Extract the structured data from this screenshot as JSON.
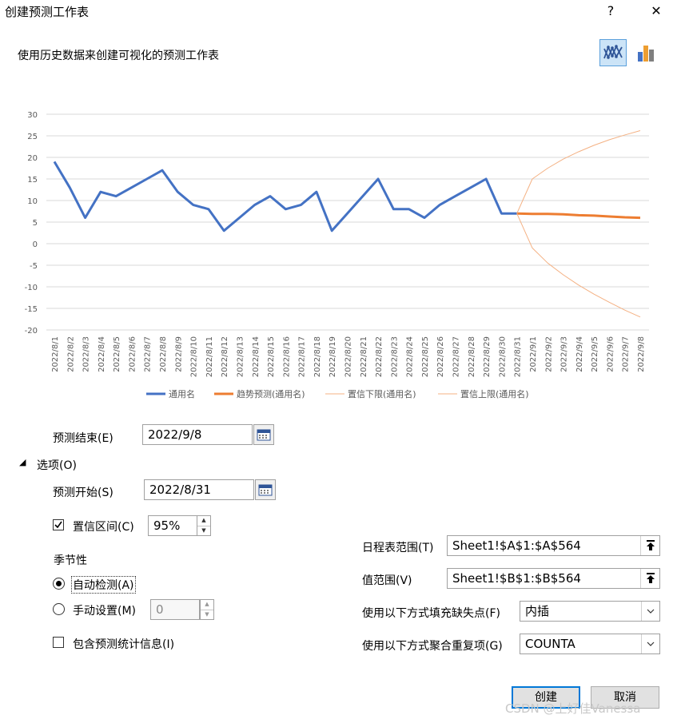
{
  "dialog": {
    "title": "创建预测工作表",
    "help_label": "?",
    "close_label": "✕",
    "subtitle": "使用历史数据来创建可视化的预测工作表"
  },
  "chart_types": [
    {
      "name": "line-chart",
      "active": true
    },
    {
      "name": "column-chart",
      "active": false
    }
  ],
  "colors": {
    "series_history": "#4472c4",
    "series_forecast": "#ed7d31",
    "series_bounds": "#f4b183",
    "gridline": "#d9d9d9",
    "accent": "#0078d7"
  },
  "chart_data": {
    "type": "line",
    "ylim": [
      -20,
      30
    ],
    "yticks": [
      "30",
      "25",
      "20",
      "15",
      "10",
      "5",
      "0",
      "-5",
      "-10",
      "-15",
      "-20"
    ],
    "x": [
      "2022/8/1",
      "2022/8/2",
      "2022/8/3",
      "2022/8/4",
      "2022/8/5",
      "2022/8/6",
      "2022/8/7",
      "2022/8/8",
      "2022/8/9",
      "2022/8/10",
      "2022/8/11",
      "2022/8/12",
      "2022/8/13",
      "2022/8/14",
      "2022/8/15",
      "2022/8/16",
      "2022/8/17",
      "2022/8/18",
      "2022/8/19",
      "2022/8/20",
      "2022/8/21",
      "2022/8/22",
      "2022/8/23",
      "2022/8/24",
      "2022/8/25",
      "2022/8/26",
      "2022/8/27",
      "2022/8/28",
      "2022/8/29",
      "2022/8/30",
      "2022/8/31",
      "2022/9/1",
      "2022/9/2",
      "2022/9/3",
      "2022/9/4",
      "2022/9/5",
      "2022/9/6",
      "2022/9/7",
      "2022/9/8"
    ],
    "grid": true,
    "legend_position": "bottom",
    "series": [
      {
        "name": "通用名",
        "start_index": 0,
        "width": 3,
        "values": [
          19,
          13,
          6,
          12,
          11,
          13,
          15,
          17,
          12,
          9,
          8,
          3,
          6,
          9,
          11,
          8,
          9,
          12,
          3,
          7,
          11,
          15,
          8,
          8,
          6,
          9,
          11,
          13,
          15,
          7,
          7
        ]
      },
      {
        "name": "趋势预测(通用名)",
        "start_index": 30,
        "width": 3,
        "values": [
          7,
          6.9,
          6.9,
          6.8,
          6.6,
          6.5,
          6.3,
          6.1,
          6
        ]
      },
      {
        "name": "置信下限(通用名)",
        "start_index": 30,
        "width": 1,
        "values": [
          7,
          -1,
          -4.5,
          -7.2,
          -9.6,
          -11.7,
          -13.6,
          -15.4,
          -17
        ]
      },
      {
        "name": "置信上限(通用名)",
        "start_index": 30,
        "width": 1,
        "values": [
          7,
          15,
          17.5,
          19.6,
          21.3,
          22.8,
          24.1,
          25.2,
          26.2
        ]
      }
    ]
  },
  "form": {
    "forecast_end_label": "预测结束(E)",
    "forecast_end_value": "2022/9/8",
    "options_label": "选项(O)",
    "forecast_start_label": "预测开始(S)",
    "forecast_start_value": "2022/8/31",
    "confidence_label": "置信区间(C)",
    "confidence_checked": true,
    "confidence_value": "95%",
    "seasonality_label": "季节性",
    "auto_detect_label": "自动检测(A)",
    "manual_label": "手动设置(M)",
    "manual_value": "0",
    "include_stats_label": "包含预测统计信息(I)",
    "timeline_label": "日程表范围(T)",
    "timeline_value": "Sheet1!$A$1:$A$564",
    "values_label": "值范围(V)",
    "values_value": "Sheet1!$B$1:$B$564",
    "fill_missing_label": "使用以下方式填充缺失点(F)",
    "fill_missing_value": "内插",
    "aggregate_label": "使用以下方式聚合重复项(G)",
    "aggregate_value": "COUNTA"
  },
  "buttons": {
    "create": "创建",
    "cancel": "取消"
  },
  "watermark": "CSDN @上好佳Vanessa"
}
